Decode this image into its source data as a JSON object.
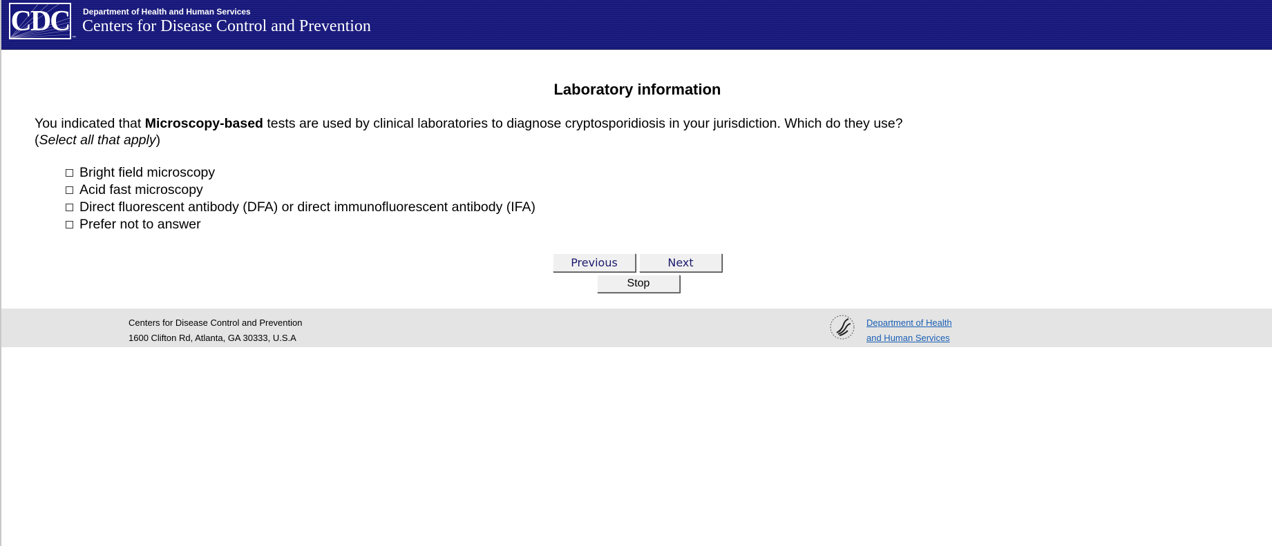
{
  "header": {
    "logo_text": "CDC",
    "department": "Department of Health and Human Services",
    "agency": "Centers for Disease Control and Prevention"
  },
  "main": {
    "title": "Laboratory information",
    "question": {
      "prefix": "You indicated that ",
      "emphasis": "Microscopy-based",
      "suffix": " tests are used by clinical laboratories to diagnose cryptosporidiosis in your jurisdiction. Which do they use?",
      "instruction_open": "(",
      "instruction": "Select all that apply",
      "instruction_close": ")"
    },
    "options": [
      {
        "label": "Bright field microscopy",
        "checked": false
      },
      {
        "label": "Acid fast microscopy",
        "checked": false
      },
      {
        "label": "Direct fluorescent antibody (DFA) or direct immunofluorescent antibody (IFA)",
        "checked": false
      },
      {
        "label": "Prefer not to answer",
        "checked": false
      }
    ]
  },
  "buttons": {
    "previous": "Previous",
    "next": "Next",
    "stop": "Stop"
  },
  "footer": {
    "org_name": "Centers for Disease Control and Prevention",
    "address": "1600 Clifton Rd, Atlanta, GA 30333, U.S.A",
    "hhs_link_line1": "Department of Health",
    "hhs_link_line2": "and Human Services",
    "hhs_icon": "hhs-eagle-icon"
  },
  "colors": {
    "header_bg": "#16177a",
    "footer_bg": "#e4e4e4",
    "link": "#1a5fb4"
  }
}
